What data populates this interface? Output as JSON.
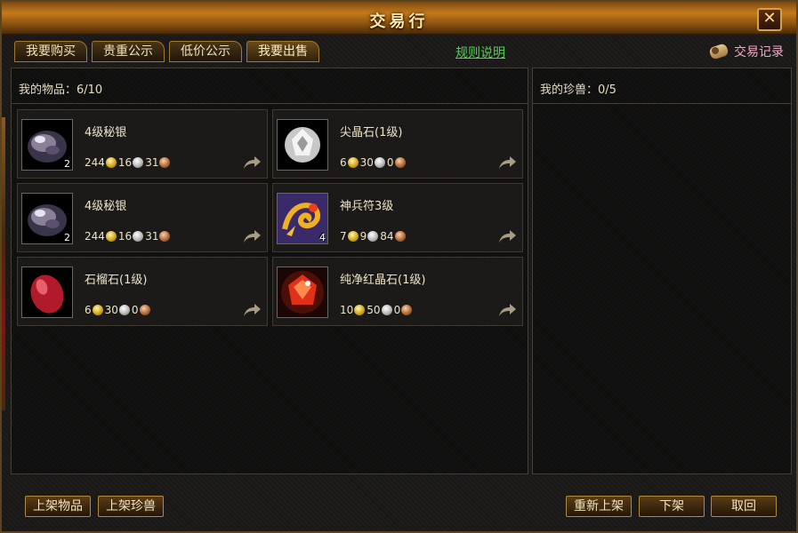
{
  "window": {
    "title": "交易行",
    "close_label": "✕"
  },
  "tabs": [
    {
      "label": "我要购买"
    },
    {
      "label": "贵重公示"
    },
    {
      "label": "低价公示"
    },
    {
      "label": "我要出售"
    }
  ],
  "rules_link": "规则说明",
  "records_label": "交易记录",
  "left_panel": {
    "header": "我的物品：6/10"
  },
  "right_panel": {
    "header": "我的珍兽：0/5"
  },
  "items": [
    {
      "name": "4级秘银",
      "count": "2",
      "gold": "244",
      "silver": "16",
      "copper": "31",
      "icon": "mithril-ore-icon"
    },
    {
      "name": "尖晶石(1级)",
      "count": "",
      "gold": "6",
      "silver": "30",
      "copper": "0",
      "icon": "spinel-gem-icon"
    },
    {
      "name": "4级秘银",
      "count": "2",
      "gold": "244",
      "silver": "16",
      "copper": "31",
      "icon": "mithril-ore-icon"
    },
    {
      "name": "神兵符3级",
      "count": "4",
      "gold": "7",
      "silver": "9",
      "copper": "84",
      "icon": "dragon-talisman-icon"
    },
    {
      "name": "石榴石(1级)",
      "count": "",
      "gold": "6",
      "silver": "30",
      "copper": "0",
      "icon": "garnet-gem-icon"
    },
    {
      "name": "纯净红晶石(1级)",
      "count": "",
      "gold": "10",
      "silver": "50",
      "copper": "0",
      "icon": "red-crystal-icon"
    }
  ],
  "buttons": {
    "list_item": "上架物品",
    "list_pet": "上架珍兽",
    "relist": "重新上架",
    "delist": "下架",
    "cancel": "取回"
  },
  "colors": {
    "accent_gold": "#c47a1c",
    "link_green": "#4fd44f",
    "records_pink": "#f0a8c8"
  }
}
